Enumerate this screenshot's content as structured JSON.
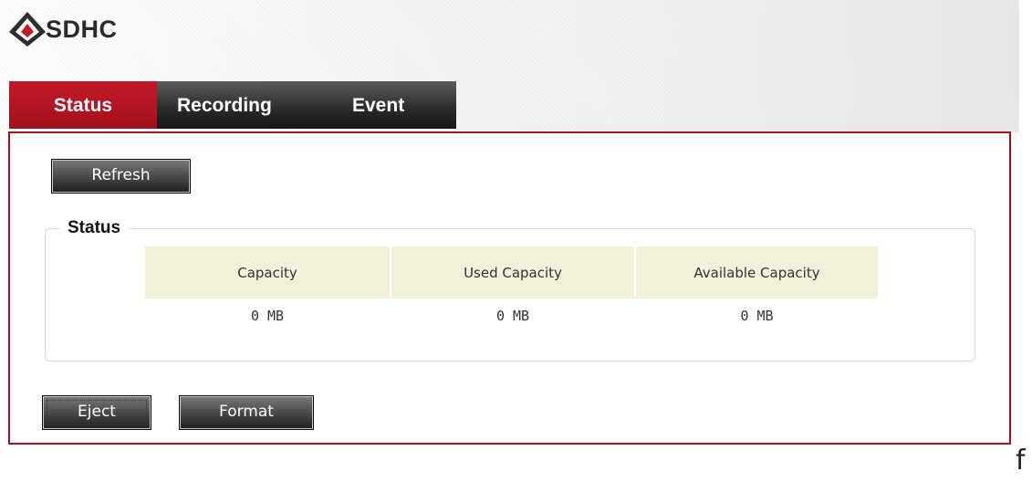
{
  "app": {
    "title": "SDHC",
    "logo_icon": "camera-brand-logo-icon",
    "brand_color": "#b31522"
  },
  "tabs": [
    {
      "label": "Status",
      "active": true
    },
    {
      "label": "Recording",
      "active": false
    },
    {
      "label": "Event",
      "active": false
    }
  ],
  "toolbar": {
    "refresh_label": "Refresh"
  },
  "status_group": {
    "legend": "Status",
    "columns": [
      "Capacity",
      "Used Capacity",
      "Available Capacity"
    ],
    "values": [
      "0 MB",
      "0 MB",
      "0 MB"
    ],
    "header_color": "#f1f0da"
  },
  "actions": {
    "eject_label": "Eject",
    "format_label": "Format"
  },
  "stray_text": "f"
}
